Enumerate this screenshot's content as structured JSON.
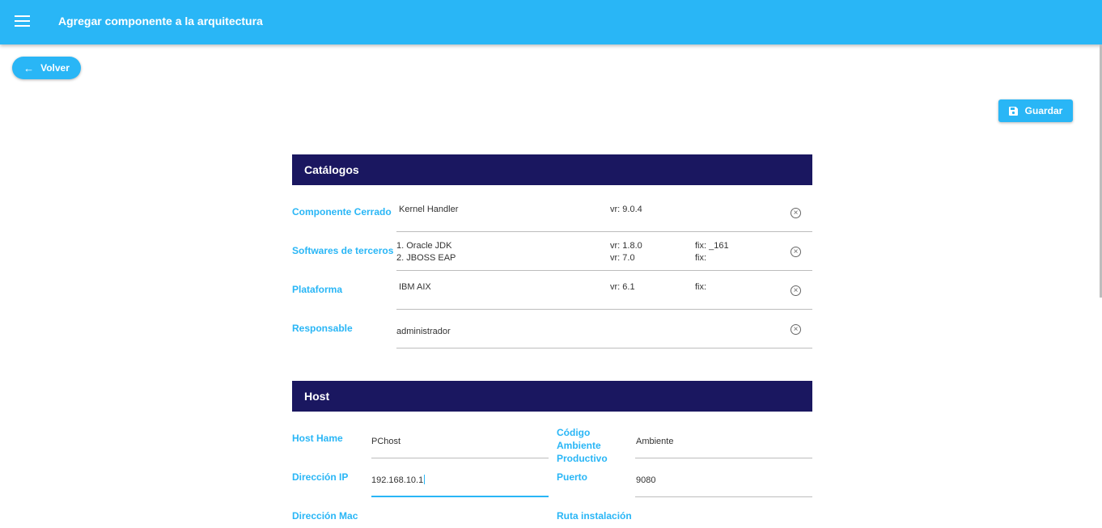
{
  "header": {
    "title": "Agregar componente a la arquitectura",
    "menu_icon": "menu-icon"
  },
  "actions": {
    "back_label": "Volver",
    "save_label": "Guardar"
  },
  "catalogs": {
    "title": "Catálogos",
    "componente": {
      "label": "Componente Cerrado",
      "name": "Kernel Handler",
      "version": "vr: 9.0.4"
    },
    "softwares": {
      "label": "Softwares de terceros",
      "items": [
        {
          "name": "1. Oracle JDK",
          "version": "vr: 1.8.0",
          "fix": "fix: _161"
        },
        {
          "name": "2. JBOSS EAP",
          "version": "vr: 7.0",
          "fix": "fix:"
        }
      ]
    },
    "plataforma": {
      "label": "Plataforma",
      "name": "IBM AIX",
      "version": "vr: 6.1",
      "fix": "fix:"
    },
    "responsable": {
      "label": "Responsable",
      "value": "administrador"
    }
  },
  "host": {
    "title": "Host",
    "host_name": {
      "label": "Host Hame",
      "value": "PChost"
    },
    "codigo": {
      "label": "Código Ambiente Productivo",
      "value": "Ambiente"
    },
    "ip": {
      "label": "Dirección IP",
      "value": "192.168.10.1"
    },
    "puerto": {
      "label": "Puerto",
      "value": "9080"
    },
    "mac": {
      "label": "Dirección Mac"
    },
    "ruta": {
      "label": "Ruta instalación"
    }
  },
  "colors": {
    "primary": "#29b6f6",
    "header_bg": "#1a1760"
  }
}
